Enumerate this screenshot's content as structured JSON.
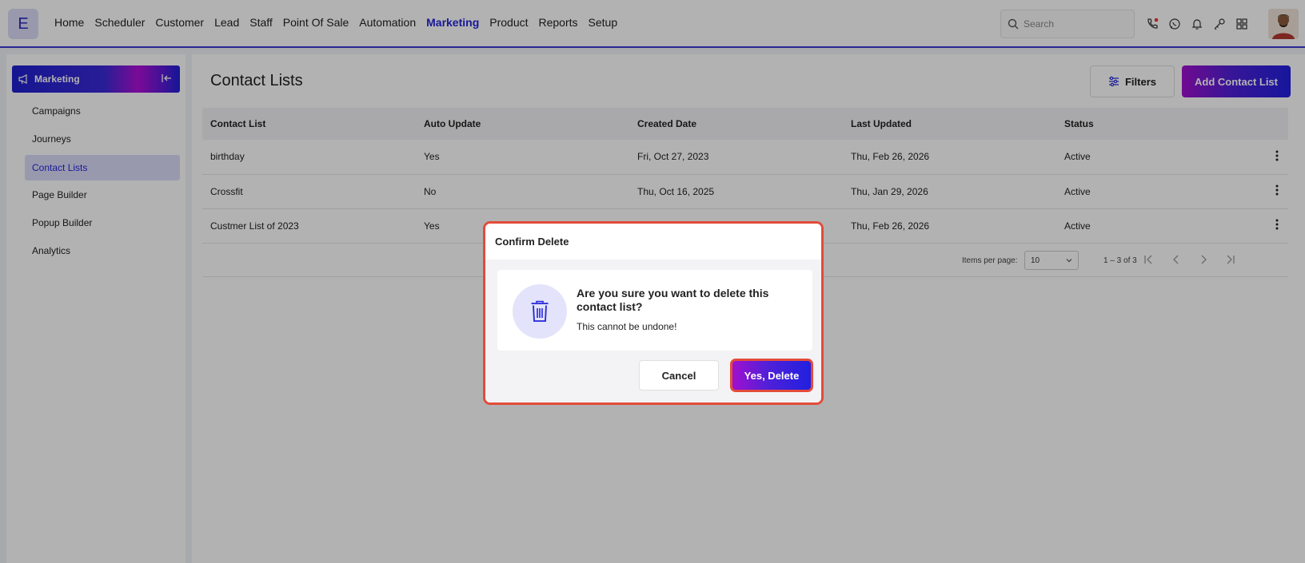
{
  "topbar": {
    "logo_letter": "E",
    "nav": [
      "Home",
      "Scheduler",
      "Customer",
      "Lead",
      "Staff",
      "Point Of Sale",
      "Automation",
      "Marketing",
      "Product",
      "Reports",
      "Setup"
    ],
    "active_nav": "Marketing",
    "search_placeholder": "Search",
    "icons": [
      "phone-icon",
      "whatsapp-icon",
      "bell-icon",
      "key-icon",
      "grid-icon"
    ]
  },
  "sidebar": {
    "title": "Marketing",
    "items": [
      "Campaigns",
      "Journeys",
      "Contact Lists",
      "Page Builder",
      "Popup Builder",
      "Analytics"
    ],
    "active_item": "Contact Lists"
  },
  "main": {
    "title": "Contact Lists",
    "filters_label": "Filters",
    "add_label": "Add Contact List",
    "columns": [
      "Contact List",
      "Auto Update",
      "Created Date",
      "Last Updated",
      "Status"
    ],
    "rows": [
      [
        "birthday",
        "Yes",
        "Fri, Oct 27, 2023",
        "Thu, Feb 26, 2026",
        "Active"
      ],
      [
        "Crossfit",
        "No",
        "Thu, Oct 16, 2025",
        "Thu, Jan 29, 2026",
        "Active"
      ],
      [
        "Custmer List of 2023",
        "Yes",
        "",
        "Thu, Feb 26, 2026",
        "Active"
      ]
    ],
    "pager": {
      "items_per_page_label": "Items per page:",
      "items_per_page": "10",
      "range": "1 – 3 of 3"
    }
  },
  "dialog": {
    "title": "Confirm Delete",
    "question": "Are you sure you want to delete this contact list?",
    "subtext": "This cannot be undone!",
    "cancel_label": "Cancel",
    "confirm_label": "Yes, Delete"
  },
  "colors": {
    "accent": "#2525d9",
    "gradient_start": "#a010d0",
    "gradient_end": "#2020e0",
    "dialog_highlight": "#e34b3a"
  }
}
